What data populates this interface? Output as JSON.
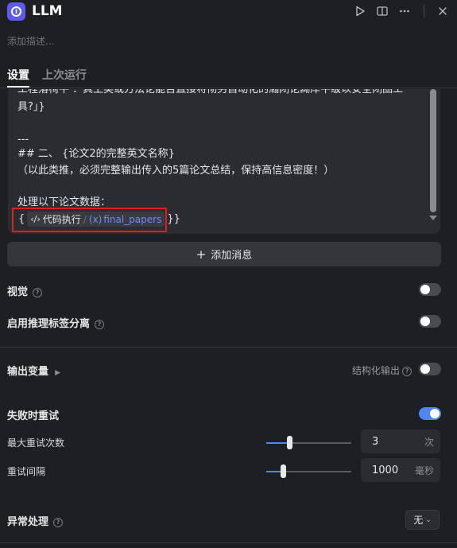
{
  "header": {
    "title": "LLM",
    "icons": [
      "llm-node-icon",
      "play-icon",
      "panel-icon",
      "more-icon",
      "close-icon"
    ]
  },
  "description_placeholder": "添加描述...",
  "tabs": [
    {
      "label": "设置",
      "active": true
    },
    {
      "label": "上次运行",
      "active": false
    }
  ],
  "editor": {
    "lines": [
      "工程落椅平   ：真上矣或方法论能否直接将彻另自动化的瀚闭论黝岸平级以安全闭圈工",
      "具?」}",
      "",
      "---",
      "## 二、 {论文2的完整英文名称}",
      "（以此类推，必须完整输出传入的5篇论文总结，保持高信息密度！）",
      "",
      "处理以下论文数据："
    ],
    "variable": {
      "open": "{",
      "node": "代码执行",
      "x_label": "(x)",
      "name": "final_papers",
      "close": "}}"
    }
  },
  "add_message_label": "添加消息",
  "vision": {
    "label": "视觉",
    "enabled": false
  },
  "reasoning_sep": {
    "label": "启用推理标签分离",
    "enabled": false
  },
  "output_vars": {
    "label": "输出变量",
    "structured_label": "结构化输出",
    "structured_enabled": false
  },
  "retry": {
    "label": "失败时重试",
    "enabled": true,
    "max_retries": {
      "label": "最大重试次数",
      "value": "3",
      "unit": "次",
      "level": 0.27
    },
    "interval": {
      "label": "重试间隔",
      "value": "1000",
      "unit": "毫秒",
      "level": 0.2
    }
  },
  "error_handling": {
    "label": "异常处理",
    "value": "无"
  },
  "colors": {
    "accent": "#4f86f7",
    "highlight_border": "#e01e1e",
    "icon_bg": "#5b5bf0"
  }
}
